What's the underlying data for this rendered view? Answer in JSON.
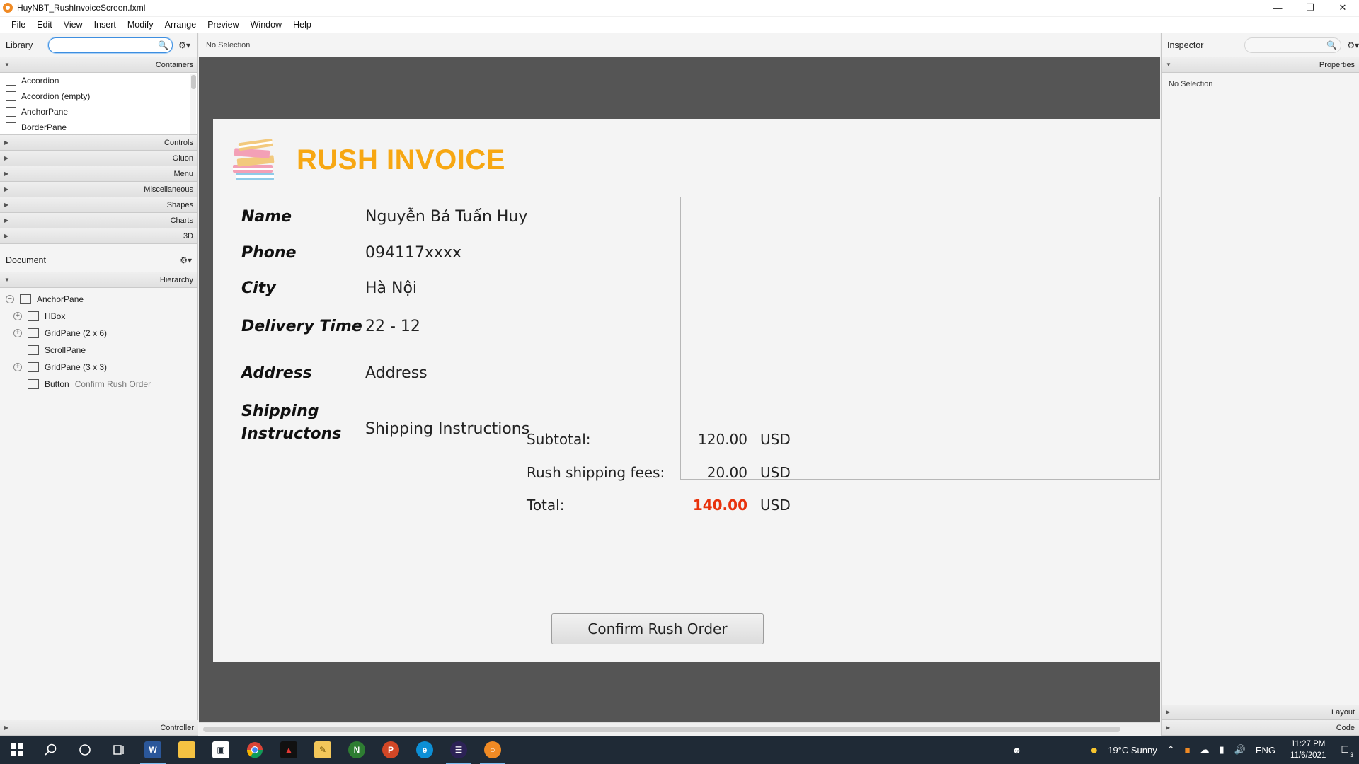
{
  "window": {
    "title": "HuyNBT_RushInvoiceScreen.fxml",
    "controls": [
      "—",
      "❐",
      "✕"
    ]
  },
  "menu": [
    "File",
    "Edit",
    "View",
    "Insert",
    "Modify",
    "Arrange",
    "Preview",
    "Window",
    "Help"
  ],
  "library": {
    "title": "Library",
    "search_value": "",
    "sections": {
      "containers": "Containers",
      "items": [
        "Accordion",
        "Accordion  (empty)",
        "AnchorPane",
        "BorderPane"
      ],
      "others": [
        "Controls",
        "Gluon",
        "Menu",
        "Miscellaneous",
        "Shapes",
        "Charts",
        "3D"
      ]
    }
  },
  "document": {
    "title": "Document",
    "hierarchy_label": "Hierarchy",
    "tree": [
      {
        "label": "AnchorPane",
        "sub": ""
      },
      {
        "label": "HBox",
        "sub": ""
      },
      {
        "label": "GridPane (2 x 6)",
        "sub": ""
      },
      {
        "label": "ScrollPane",
        "sub": ""
      },
      {
        "label": "GridPane (3 x 3)",
        "sub": ""
      },
      {
        "label": "Button",
        "sub": "Confirm Rush Order"
      }
    ],
    "controller_label": "Controller"
  },
  "canvas": {
    "selection_label": "No Selection"
  },
  "invoice": {
    "title": "RUSH INVOICE",
    "fields": {
      "name_label": "Name",
      "name_value": "Nguyễn Bá Tuấn Huy",
      "phone_label": "Phone",
      "phone_value": "094117xxxx",
      "city_label": "City",
      "city_value": "Hà Nội",
      "delivery_label": "Delivery Time",
      "delivery_value": "22 - 12",
      "address_label": "Address",
      "address_value": "Address",
      "shipping_label_1": "Shipping",
      "shipping_label_2": "Instructons",
      "shipping_value": "Shipping Instructions"
    },
    "summary": {
      "subtotal_label": "Subtotal:",
      "subtotal_value": "120.00",
      "subtotal_cur": "USD",
      "fees_label": "Rush shipping fees:",
      "fees_value": "20.00",
      "fees_cur": "USD",
      "total_label": "Total:",
      "total_value": "140.00",
      "total_cur": "USD"
    },
    "confirm_button": "Confirm Rush Order",
    "colors": {
      "title": "#f7a712",
      "total": "#e8320c"
    }
  },
  "inspector": {
    "title": "Inspector",
    "properties_label": "Properties",
    "no_selection": "No Selection",
    "layout_label": "Layout",
    "code_label": "Code"
  },
  "taskbar": {
    "weather": "19°C  Sunny",
    "language": "ENG",
    "time": "11:27 PM",
    "date": "11/6/2021",
    "notification_count": "3"
  }
}
